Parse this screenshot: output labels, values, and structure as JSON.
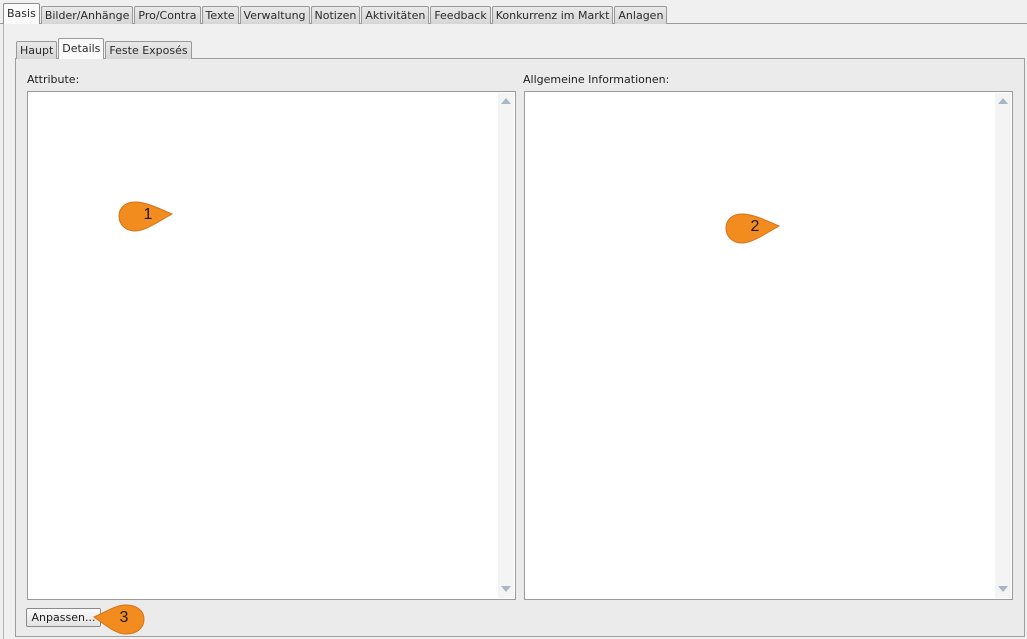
{
  "top_tabs": [
    {
      "label": "Basis",
      "active": true
    },
    {
      "label": "Bilder/Anhänge",
      "active": false
    },
    {
      "label": "Pro/Contra",
      "active": false
    },
    {
      "label": "Texte",
      "active": false
    },
    {
      "label": "Verwaltung",
      "active": false
    },
    {
      "label": "Notizen",
      "active": false
    },
    {
      "label": "Aktivitäten",
      "active": false
    },
    {
      "label": "Feedback",
      "active": false
    },
    {
      "label": "Konkurrenz im Markt",
      "active": false
    },
    {
      "label": "Anlagen",
      "active": false
    }
  ],
  "sub_tabs": [
    {
      "label": "Haupt",
      "active": false
    },
    {
      "label": "Details",
      "active": true
    },
    {
      "label": "Feste Exposés",
      "active": false
    }
  ],
  "attributes": {
    "label": "Attribute:"
  },
  "general_info": {
    "label": "Allgemeine Informationen:"
  },
  "customize_button": {
    "label": "Anpassen..."
  },
  "callouts": [
    "1",
    "2",
    "3"
  ],
  "colors": {
    "callout": "#f28c1e",
    "accent_scroll": "#a9b6c8"
  }
}
